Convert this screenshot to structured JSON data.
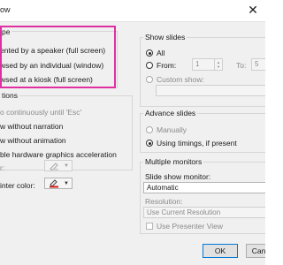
{
  "window": {
    "title": "ow",
    "close_glyph": "✕"
  },
  "show_type": {
    "label": "pe",
    "options": [
      {
        "label": "ented by a speaker (full screen)",
        "checked": true
      },
      {
        "label": "wsed by an individual (window)",
        "checked": false
      },
      {
        "label": "wsed at a kiosk (full screen)",
        "checked": false
      }
    ]
  },
  "show_options": {
    "label": "tions",
    "loop": "o continuously until 'Esc'",
    "no_narration": "w without narration",
    "no_animation": "w without animation",
    "hw_accel": "ble hardware graphics acceleration",
    "pen_label": "r:",
    "laser_label": "inter color:",
    "laser_color": "#d42020"
  },
  "show_slides": {
    "label": "Show slides",
    "all": "All",
    "from": "From:",
    "from_value": "1",
    "to": "To:",
    "to_value": "5",
    "custom": "Custom show:"
  },
  "advance": {
    "label": "Advance slides",
    "manually": "Manually",
    "timings": "Using timings, if present"
  },
  "monitors": {
    "label": "Multiple monitors",
    "monitor_label": "Slide show monitor:",
    "monitor_value": "Automatic",
    "resolution_label": "Resolution:",
    "resolution_value": "Use Current Resolution",
    "presenter": "Use Presenter View"
  },
  "buttons": {
    "ok": "OK",
    "cancel": "Cancel"
  }
}
